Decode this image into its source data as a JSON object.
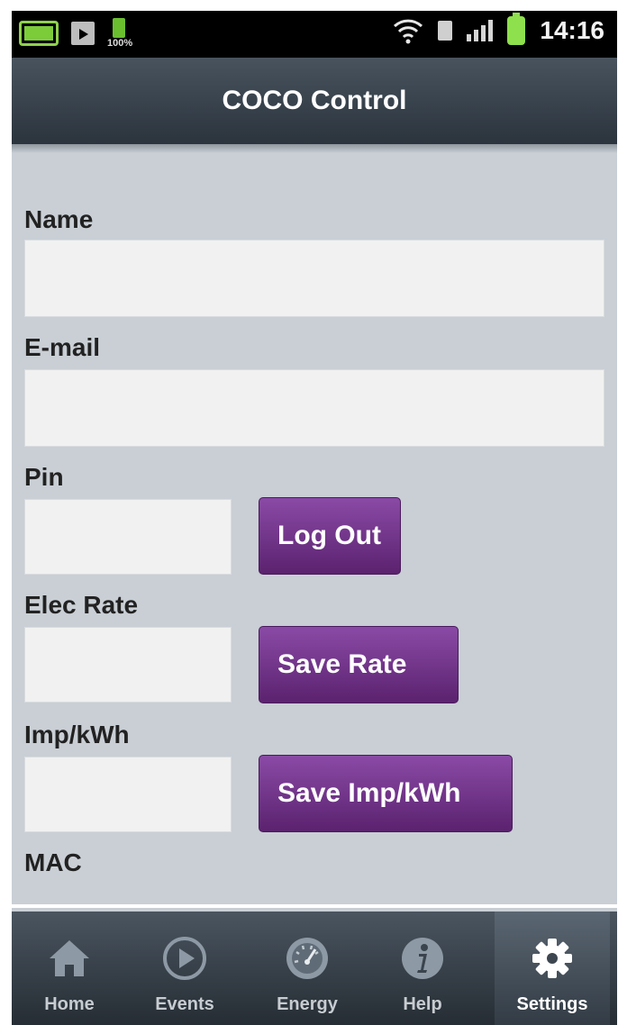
{
  "status_bar": {
    "battery_small_label": "100%",
    "time": "14:16"
  },
  "header": {
    "title": "COCO Control"
  },
  "form": {
    "name_label": "Name",
    "name_value": "",
    "email_label": "E-mail",
    "email_value": "",
    "pin_label": "Pin",
    "pin_value": "",
    "logout_label": "Log Out",
    "elec_rate_label": "Elec Rate",
    "elec_rate_value": "",
    "save_rate_label": "Save Rate",
    "imp_kwh_label": "Imp/kWh",
    "imp_kwh_value": "",
    "save_imp_label": "Save Imp/kWh",
    "mac_label": "MAC"
  },
  "tabs": [
    {
      "label": "Home",
      "icon": "home-icon"
    },
    {
      "label": "Events",
      "icon": "play-circle-icon"
    },
    {
      "label": "Energy",
      "icon": "gauge-icon"
    },
    {
      "label": "Help",
      "icon": "info-icon"
    },
    {
      "label": "Settings",
      "icon": "gear-icon",
      "active": true
    }
  ],
  "colors": {
    "accent_button": "#6a2e82",
    "title_bar": "#38424c",
    "background": "#c9cfd5"
  }
}
